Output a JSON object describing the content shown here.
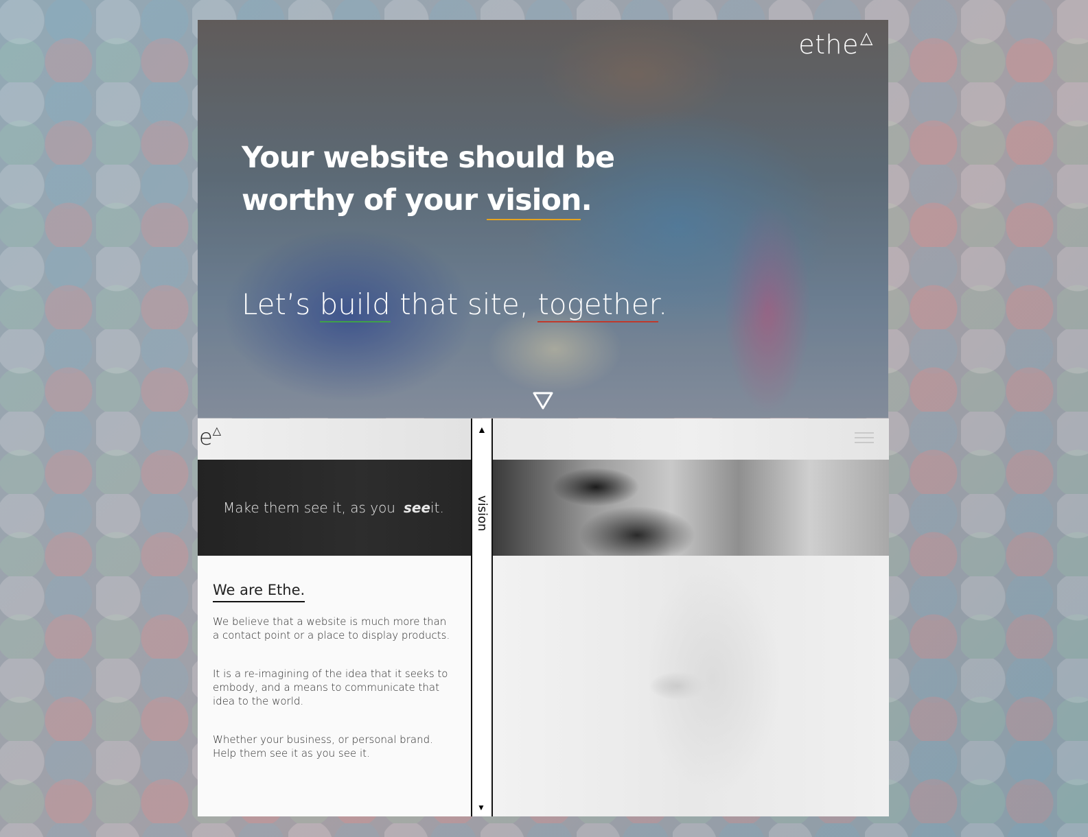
{
  "hero": {
    "logo_text": "ethe",
    "logo_mark": "△",
    "headline_line1": "Your website should be",
    "headline_line2_pre": "worthy of your ",
    "headline_highlight": "vision",
    "headline_period": ".",
    "subline_pre": "Let’s ",
    "subline_word1": "build",
    "subline_mid": " that site, ",
    "subline_word2": "together",
    "subline_end": ".",
    "scroll_icon": "triangle-down-icon"
  },
  "panel": {
    "logo_text": "e",
    "logo_mark": "△",
    "banner_pre": "Make them see it, as you ",
    "banner_see": "see",
    "banner_post": "it.",
    "title": "We are Ethe.",
    "paragraphs": [
      "We believe that a website is much more than a contact point or a place to display products.",
      "It is a re-imagining of the idea that it seeks to embody, and a means to communicate that idea to the world.",
      "Whether your business, or personal brand. Help them see it as you see it."
    ],
    "divider_label": "vision",
    "divider_up": "▲",
    "divider_down": "▼"
  },
  "colors": {
    "accent_gold": "#e7a41e",
    "accent_green": "#3fa04a",
    "accent_red": "#c0392b"
  }
}
